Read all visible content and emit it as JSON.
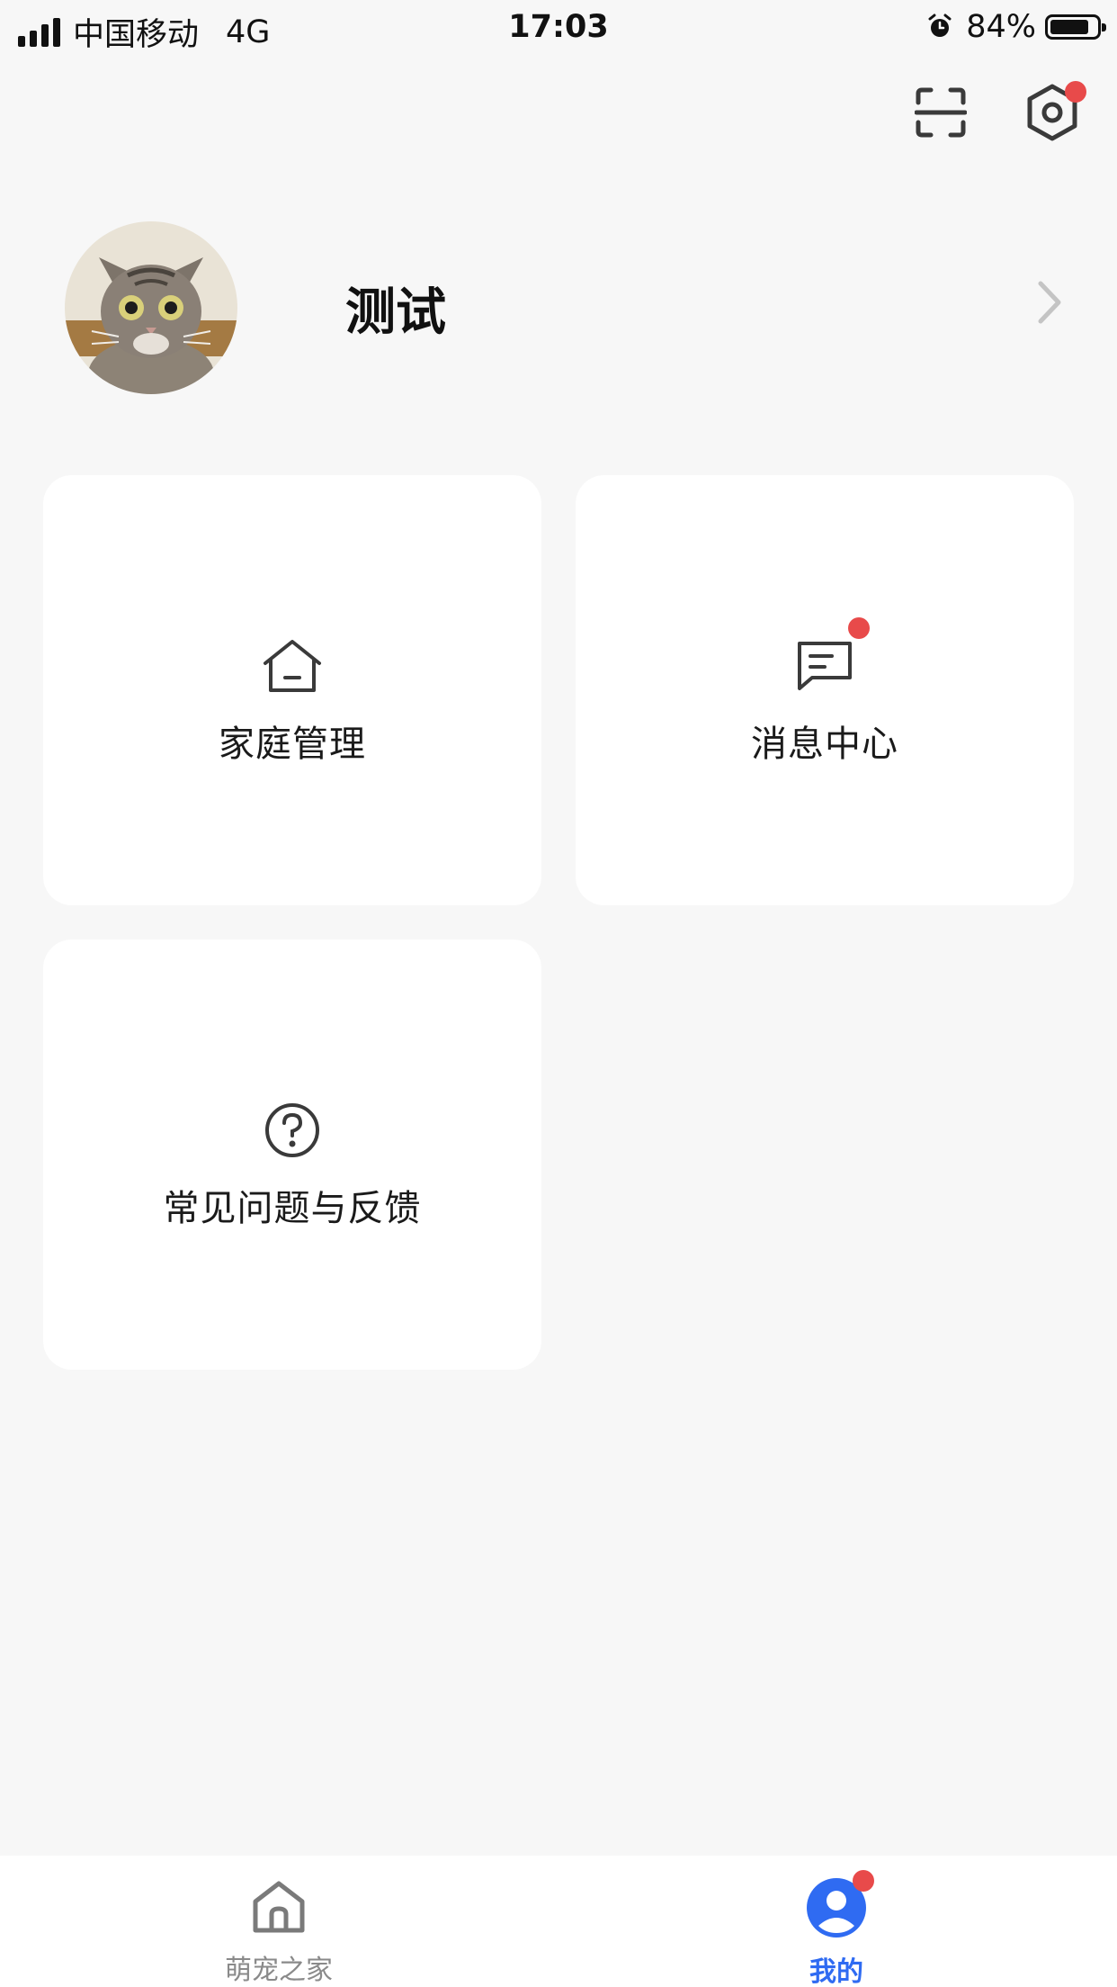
{
  "status_bar": {
    "carrier": "中国移动",
    "network": "4G",
    "time": "17:03",
    "battery_percent": "84%",
    "battery_level": 0.84
  },
  "top_actions": {
    "scan_icon": "scan-icon",
    "settings_icon": "settings-hexagon-icon",
    "settings_has_badge": true
  },
  "profile": {
    "username": "测试",
    "avatar": "cat-avatar"
  },
  "cards": [
    {
      "label": "家庭管理",
      "icon": "house-icon",
      "badge": false
    },
    {
      "label": "消息中心",
      "icon": "message-icon",
      "badge": true
    },
    {
      "label": "常见问题与反馈",
      "icon": "question-icon",
      "badge": false
    }
  ],
  "tab_bar": {
    "tabs": [
      {
        "label": "萌宠之家",
        "icon": "home-tab-icon",
        "active": false
      },
      {
        "label": "我的",
        "icon": "profile-tab-icon",
        "active": true,
        "badge": true
      }
    ]
  },
  "colors": {
    "background": "#f7f7f7",
    "card": "#ffffff",
    "accent": "#2f6bf2",
    "badge": "#e84a4a",
    "inactive_text": "#8a8a8a"
  }
}
